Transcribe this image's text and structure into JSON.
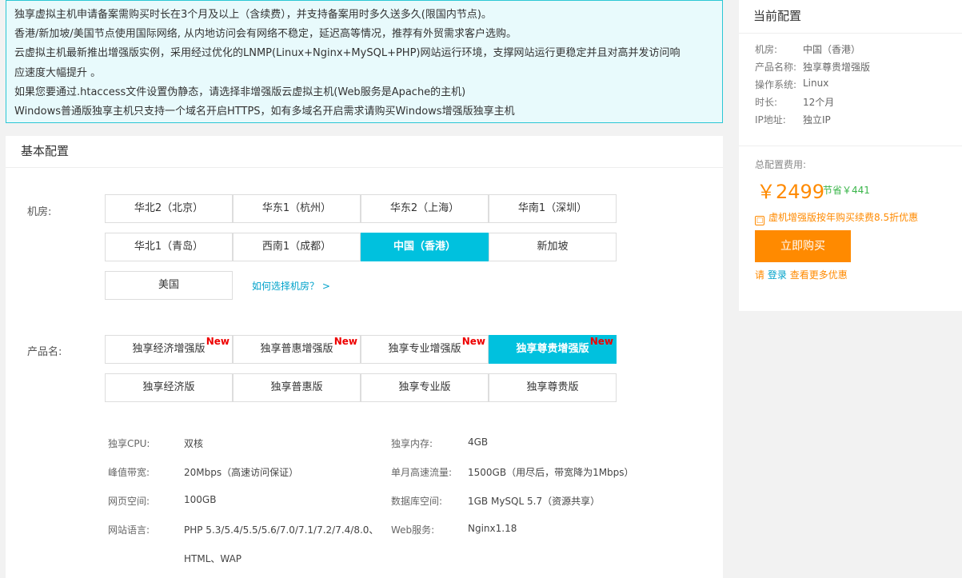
{
  "notice": {
    "lines": [
      "独享虚拟主机申请备案需购买时长在3个月及以上（含续费），并支持备案用时多久送多久(限国内节点)。",
      "香港/新加坡/美国节点使用国际网络, 从内地访问会有网络不稳定，延迟高等情况，推荐有外贸需求客户选购。",
      "云虚拟主机最新推出增强版实例，采用经过优化的LNMP(Linux+Nginx+MySQL+PHP)网站运行环境，支撑网站运行更稳定并且对高并发访问响",
      "应速度大幅提升 。",
      "如果您要通过.htaccess文件设置伪静态，请选择非增强版云虚拟主机(Web服务是Apache的主机)",
      "Windows普通版独享主机只支持一个域名开启HTTPS，如有多域名开启需求请购买Windows增强版独享主机"
    ]
  },
  "main": {
    "title": "基本配置",
    "region": {
      "label": "机房:",
      "options": [
        "华北2（北京）",
        "华东1（杭州）",
        "华东2（上海）",
        "华南1（深圳）",
        "华北1（青岛）",
        "西南1（成都）",
        "中国（香港）",
        "新加坡",
        "美国"
      ],
      "selected": "中国（香港）",
      "help_link": "如何选择机房？ >"
    },
    "product": {
      "label": "产品名:",
      "new_badge": "New",
      "options": [
        "独享经济增强版",
        "独享普惠增强版",
        "独享专业增强版",
        "独享尊贵增强版",
        "独享经济版",
        "独享普惠版",
        "独享专业版",
        "独享尊贵版"
      ],
      "selected": "独享尊贵增强版"
    },
    "specs": {
      "cpu_label": "独享CPU:",
      "cpu_value": "双核",
      "memory_label": "独享内存:",
      "memory_value": "4GB",
      "bandwidth_label": "峰值带宽:",
      "bandwidth_value": "20Mbps（高速访问保证）",
      "traffic_label": "单月高速流量:",
      "traffic_value": "1500GB（用尽后，带宽降为1Mbps）",
      "webspace_label": "网页空间:",
      "webspace_value": "100GB",
      "database_label": "数据库空间:",
      "database_value": "1GB MySQL 5.7（资源共享）",
      "language_label": "网站语言:",
      "language_value_1": "PHP 5.3/5.4/5.5/5.6/7.0/7.1/7.2/7.4/8.0、",
      "language_value_2": "HTML、WAP",
      "webserver_label": "Web服务:",
      "webserver_value": "Nginx1.18"
    }
  },
  "side": {
    "title": "当前配置",
    "region_label": "机房:",
    "region_value": "中国（香港）",
    "product_label": "产品名称:",
    "product_value": "独享尊贵增强版",
    "os_label": "操作系统:",
    "os_value": "Linux",
    "duration_label": "时长:",
    "duration_value": "12个月",
    "ip_label": "IP地址:",
    "ip_value": "独立IP",
    "total_label": "总配置费用:",
    "price": "￥2499",
    "save": "节省￥441",
    "promo": "虚机增强版按年购买续费8.5折优惠",
    "buy_button": "立即购买",
    "login_prefix": "请",
    "login_link": "登录",
    "more_offers": "查看更多优惠",
    "colors": {
      "accent": "#00c1de",
      "price": "#ff8a00",
      "save": "#3ab54a",
      "new_badge": "#ee0000"
    }
  }
}
